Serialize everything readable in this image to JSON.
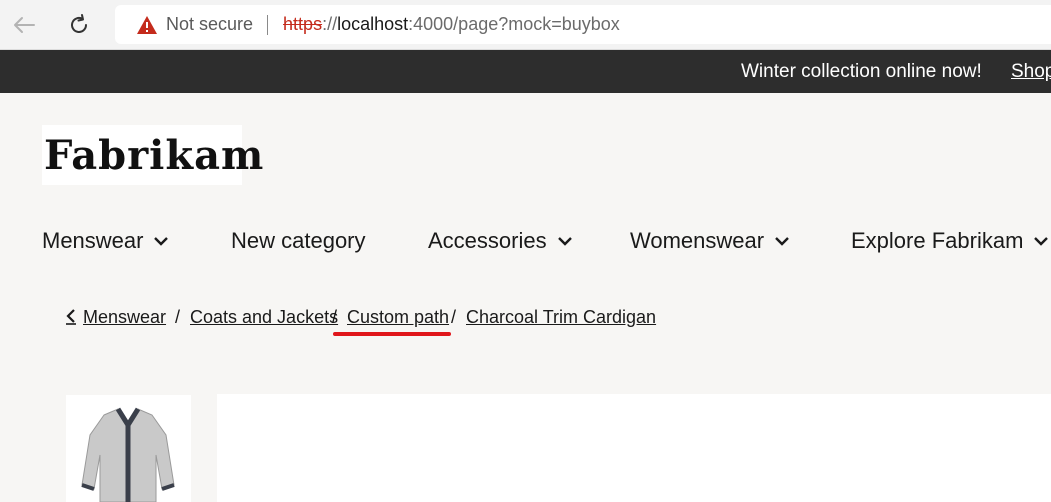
{
  "browser": {
    "security_label": "Not secure",
    "url_protocol": "https",
    "url_separator": "://",
    "url_host": "localhost",
    "url_rest": ":4000/page?mock=buybox"
  },
  "promo": {
    "message": "Winter collection online now!",
    "link_label": "Shop"
  },
  "brand": {
    "logo_text": "Fabrikam"
  },
  "nav": {
    "items": [
      {
        "label": "Menswear",
        "has_dropdown": true
      },
      {
        "label": "New category",
        "has_dropdown": false
      },
      {
        "label": "Accessories",
        "has_dropdown": true
      },
      {
        "label": "Womenswear",
        "has_dropdown": true
      },
      {
        "label": "Explore Fabrikam",
        "has_dropdown": true
      }
    ]
  },
  "breadcrumb": {
    "items": [
      "Menswear",
      "Coats and Jackets",
      "Custom path",
      "Charcoal Trim Cardigan"
    ],
    "separator": "/",
    "highlight_color": "#e0161b"
  },
  "colors": {
    "promo_bg": "#2d2d2d",
    "page_bg": "#f7f6f4",
    "warning": "#c42b1c"
  }
}
